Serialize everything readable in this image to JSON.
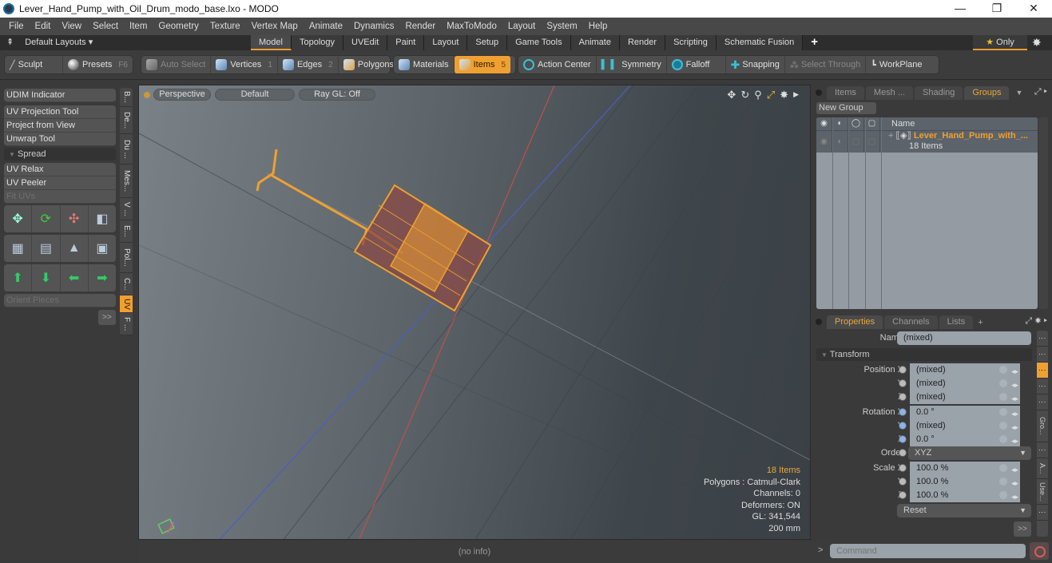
{
  "window": {
    "title": "Lever_Hand_Pump_with_Oil_Drum_modo_base.lxo - MODO",
    "minimize": "—",
    "maximize": "❐",
    "close": "✕"
  },
  "menu": [
    "File",
    "Edit",
    "View",
    "Select",
    "Item",
    "Geometry",
    "Texture",
    "Vertex Map",
    "Animate",
    "Dynamics",
    "Render",
    "MaxToModo",
    "Layout",
    "System",
    "Help"
  ],
  "layoutbar": {
    "layouts_label": "Default Layouts ▾",
    "tabs": [
      "Model",
      "Topology",
      "UVEdit",
      "Paint",
      "Layout",
      "Setup",
      "Game Tools",
      "Animate",
      "Render",
      "Scripting",
      "Schematic Fusion"
    ],
    "active_tab": "Model",
    "add_tab": "+",
    "only_label": "Only",
    "star": "★"
  },
  "toolbar": {
    "sculpt": "Sculpt",
    "presets": "Presets",
    "presets_key": "F6",
    "auto_select": "Auto Select",
    "vertices": "Vertices",
    "vertices_key": "1",
    "edges": "Edges",
    "edges_key": "2",
    "polygons": "Polygons",
    "materials": "Materials",
    "items": "Items",
    "items_key": "5",
    "action_center": "Action Center",
    "symmetry": "Symmetry",
    "falloff": "Falloff",
    "snapping": "Snapping",
    "select_through": "Select Through",
    "workplane": "WorkPlane"
  },
  "leftpanel": {
    "udim": "UDIM Indicator",
    "group1": [
      "UV Projection Tool",
      "Project from View",
      "Unwrap Tool"
    ],
    "spread_label": "Spread",
    "group2": [
      "UV Relax",
      "UV Peeler",
      "Fit UVs"
    ],
    "orient": "Orient Pieces",
    "more": ">>",
    "vtabs": [
      "B...",
      "De...",
      "Du ...",
      "Mes...",
      "V ...",
      "E...",
      "Pol...",
      "C...",
      "UV",
      "F ..."
    ],
    "active_vtab": "UV"
  },
  "viewport": {
    "view_mode": "Perspective",
    "shading": "Default",
    "raygl": "Ray GL: Off",
    "info": {
      "items": "18 Items",
      "polygons": "Polygons : Catmull-Clark",
      "channels": "Channels: 0",
      "deformers": "Deformers: ON",
      "gl": "GL: 341,544",
      "scale": "200 mm"
    },
    "status": "(no info)"
  },
  "groups_panel": {
    "tabs": [
      "Items",
      "Mesh ...",
      "Shading",
      "Groups"
    ],
    "active_tab": "Groups",
    "new_group": "New Group",
    "name_header": "Name",
    "group_name": "Lever_Hand_Pump_with_...",
    "group_count": "18 Items"
  },
  "properties_panel": {
    "tabs": [
      "Properties",
      "Channels",
      "Lists"
    ],
    "active_tab": "Properties",
    "add_tab": "+",
    "name_label": "Name",
    "name_value": "(mixed)",
    "transform_label": "Transform",
    "position": {
      "label": "Position X",
      "x": "(mixed)",
      "y": "(mixed)",
      "z": "(mixed)"
    },
    "rotation": {
      "label": "Rotation X",
      "x": "0.0 °",
      "y": "(mixed)",
      "z": "0.0 °"
    },
    "order_label": "Order",
    "order_value": "XYZ",
    "scale": {
      "label": "Scale X",
      "x": "100.0 %",
      "y": "100.0 %",
      "z": "100.0 %"
    },
    "axis_y": "Y",
    "axis_z": "Z",
    "reset": "Reset",
    "more": ">>",
    "side_tabs": [
      "⋮",
      "⋮",
      "⋮",
      "⋮",
      "⋮",
      "Gro...",
      "⋮",
      "A...",
      "Use...",
      "⋮"
    ]
  },
  "command": {
    "prompt": ">",
    "placeholder": "Command"
  },
  "colors": {
    "accent": "#f0a030",
    "selection": "#e8a838",
    "viewport_bg": "#5d656b"
  }
}
